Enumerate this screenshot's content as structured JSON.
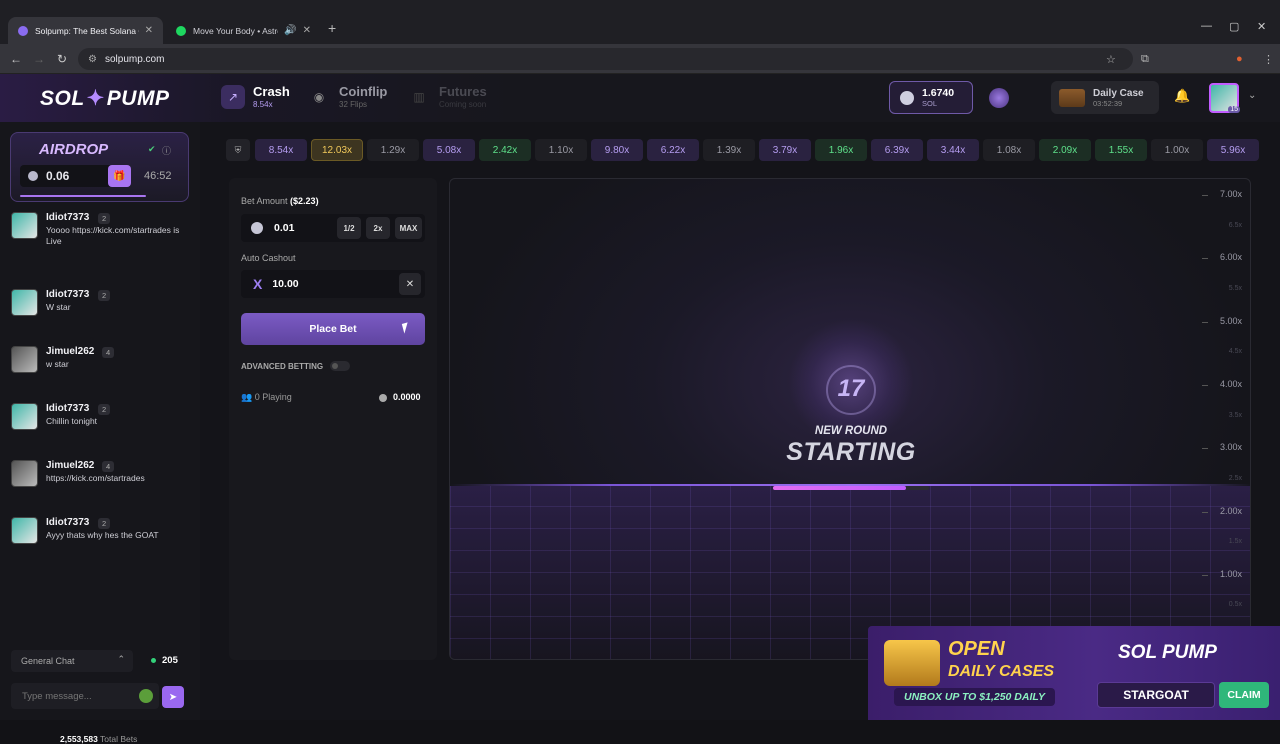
{
  "browser": {
    "tabs": [
      {
        "title": "Solpump: The Best Solana Casi",
        "active": true,
        "color": "#8a6cf0"
      },
      {
        "title": "Move Your Body • AstroHe",
        "active": false,
        "color": "#1ed760"
      }
    ],
    "url": "solpump.com"
  },
  "header": {
    "logo_left": "SOL",
    "logo_right": "PUMP",
    "games": [
      {
        "name": "Crash",
        "sub": "8.54x",
        "state": "active"
      },
      {
        "name": "Coinflip",
        "sub": "32 Flips",
        "state": "normal"
      },
      {
        "name": "Futures",
        "sub": "Coming soon",
        "state": "disabled"
      }
    ],
    "balance": {
      "amount": "1.6740",
      "unit": "SOL"
    },
    "daily_case": {
      "title": "Daily Case",
      "timer": "03:52:39"
    },
    "avatar_level": "15"
  },
  "sidebar": {
    "airdrop": {
      "title": "AIRDROP",
      "amount": "0.06",
      "timer": "46:52",
      "progress_fraction": 0.7
    },
    "messages": [
      {
        "user": "Idiot7373",
        "level": "2",
        "text": "Yoooo https://kick.com/startrades is Live",
        "avatar": "teal"
      },
      {
        "user": "Idiot7373",
        "level": "2",
        "text": "W star",
        "avatar": "teal"
      },
      {
        "user": "Jimuel262",
        "level": "4",
        "text": "w star",
        "avatar": "gray"
      },
      {
        "user": "Idiot7373",
        "level": "2",
        "text": "Chillin tonight",
        "avatar": "teal"
      },
      {
        "user": "Jimuel262",
        "level": "4",
        "text": "https://kick.com/startrades",
        "avatar": "gray"
      },
      {
        "user": "Idiot7373",
        "level": "2",
        "text": "Ayyy thats why hes the GOAT",
        "avatar": "teal"
      }
    ],
    "chat_room": "General Chat",
    "online_count": "205",
    "message_placeholder": "Type message...",
    "total_bets_value": "2,553,583",
    "total_bets_label": "Total Bets"
  },
  "history": [
    {
      "v": "8.54x",
      "c": "purple"
    },
    {
      "v": "12.03x",
      "c": "gold"
    },
    {
      "v": "1.29x",
      "c": "gray"
    },
    {
      "v": "5.08x",
      "c": "purple"
    },
    {
      "v": "2.42x",
      "c": "green"
    },
    {
      "v": "1.10x",
      "c": "gray"
    },
    {
      "v": "9.80x",
      "c": "purple"
    },
    {
      "v": "6.22x",
      "c": "purple"
    },
    {
      "v": "1.39x",
      "c": "gray"
    },
    {
      "v": "3.79x",
      "c": "purple"
    },
    {
      "v": "1.96x",
      "c": "green"
    },
    {
      "v": "6.39x",
      "c": "purple"
    },
    {
      "v": "3.44x",
      "c": "purple"
    },
    {
      "v": "1.08x",
      "c": "gray"
    },
    {
      "v": "2.09x",
      "c": "green"
    },
    {
      "v": "1.55x",
      "c": "green"
    },
    {
      "v": "1.00x",
      "c": "gray"
    },
    {
      "v": "5.96x",
      "c": "purple"
    }
  ],
  "bet": {
    "amount_label": "Bet Amount",
    "amount_usd": "($2.23)",
    "amount_value": "0.01",
    "half_label": "1/2",
    "double_label": "2x",
    "max_label": "MAX",
    "autocashout_label": "Auto Cashout",
    "autocashout_value": "10.00",
    "place_label": "Place Bet",
    "advanced_label": "ADVANCED BETTING",
    "playing_label": "0 Playing",
    "pot_value": "0.0000"
  },
  "game": {
    "countdown": "17",
    "newround": "NEW ROUND",
    "status": "STARTING",
    "progress_fraction": 0.85,
    "axis_major": [
      "7.00x",
      "6.00x",
      "5.00x",
      "4.00x",
      "3.00x",
      "2.00x",
      "1.00x"
    ],
    "axis_minor": [
      "6.5x",
      "5.5x",
      "4.5x",
      "3.5x",
      "2.5x",
      "1.5x",
      "0.5x"
    ]
  },
  "banner": {
    "open": "OPEN",
    "cases": "DAILY CASES",
    "unbox": "UNBOX UP TO $1,250 DAILY",
    "logo": "SOL PUMP",
    "code": "STARGOAT",
    "claim": "CLAIM"
  },
  "colors": {
    "accent": "#9a68f0",
    "gold": "#f0c85a",
    "green": "#5ee08a"
  }
}
